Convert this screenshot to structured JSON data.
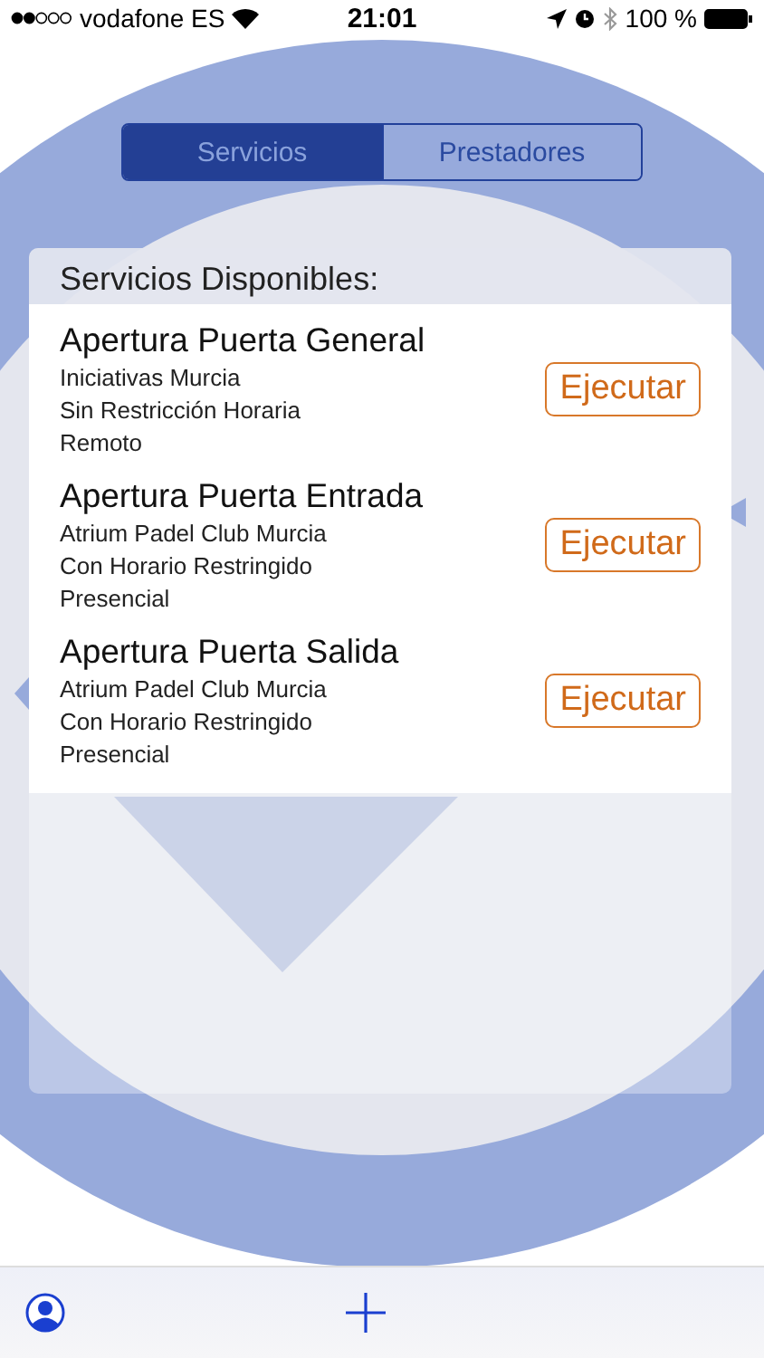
{
  "status_bar": {
    "carrier": "vodafone ES",
    "time": "21:01",
    "battery": "100 %"
  },
  "segments": [
    {
      "label": "Servicios",
      "selected": true
    },
    {
      "label": "Prestadores",
      "selected": false
    }
  ],
  "card": {
    "title": "Servicios Disponibles:",
    "services": [
      {
        "name": "Apertura Puerta General",
        "lines": [
          "Iniciativas Murcia",
          "Sin Restricción Horaria",
          "Remoto"
        ],
        "action": "Ejecutar"
      },
      {
        "name": "Apertura Puerta Entrada",
        "lines": [
          "Atrium Padel Club Murcia",
          "Con Horario Restringido",
          "Presencial"
        ],
        "action": "Ejecutar"
      },
      {
        "name": "Apertura Puerta Salida",
        "lines": [
          "Atrium Padel Club Murcia",
          "Con Horario Restringido",
          "Presencial"
        ],
        "action": "Ejecutar"
      }
    ]
  }
}
